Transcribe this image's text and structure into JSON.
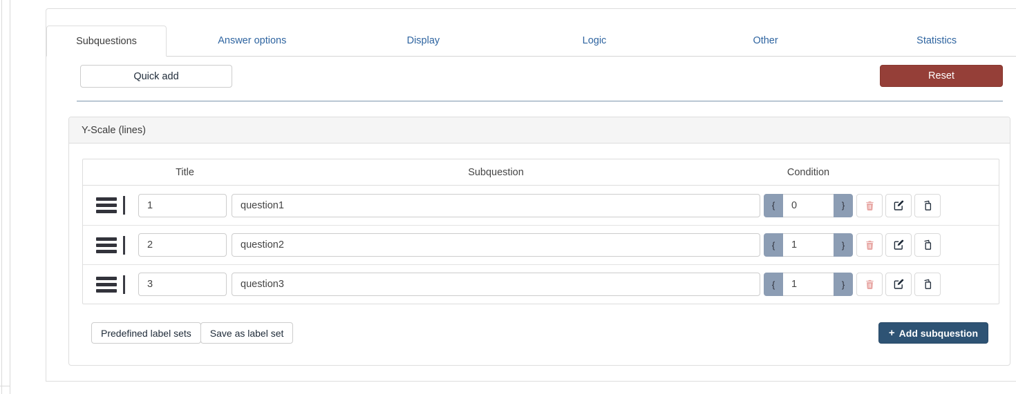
{
  "tabs": [
    {
      "label": "Subquestions",
      "active": true
    },
    {
      "label": "Answer options",
      "active": false
    },
    {
      "label": "Display",
      "active": false
    },
    {
      "label": "Logic",
      "active": false
    },
    {
      "label": "Other",
      "active": false
    },
    {
      "label": "Statistics",
      "active": false
    }
  ],
  "toolbar": {
    "quick_add_label": "Quick add",
    "reset_label": "Reset"
  },
  "panel": {
    "title": "Y-Scale (lines)",
    "table": {
      "headers": {
        "title": "Title",
        "subquestion": "Subquestion",
        "condition": "Condition"
      },
      "condition_prefix": "{",
      "condition_suffix": "}",
      "rows": [
        {
          "title": "1",
          "subquestion": "question1",
          "condition": "0"
        },
        {
          "title": "2",
          "subquestion": "question2",
          "condition": "1"
        },
        {
          "title": "3",
          "subquestion": "question3",
          "condition": "1"
        }
      ]
    },
    "footer": {
      "predefined_label": "Predefined label sets",
      "save_label": "Save as label set",
      "add_icon": "+",
      "add_label": "Add subquestion"
    }
  },
  "colors": {
    "tab_link_blue": "#2e64a0",
    "reset_red": "#953f38",
    "divider_blue": "#7b95ad",
    "condition_addon_blue": "#8c9db4",
    "add_button_navy": "#2e5374",
    "trash_icon_pink": "#e8a7a4",
    "panel_header_grey": "#f5f5f5"
  }
}
